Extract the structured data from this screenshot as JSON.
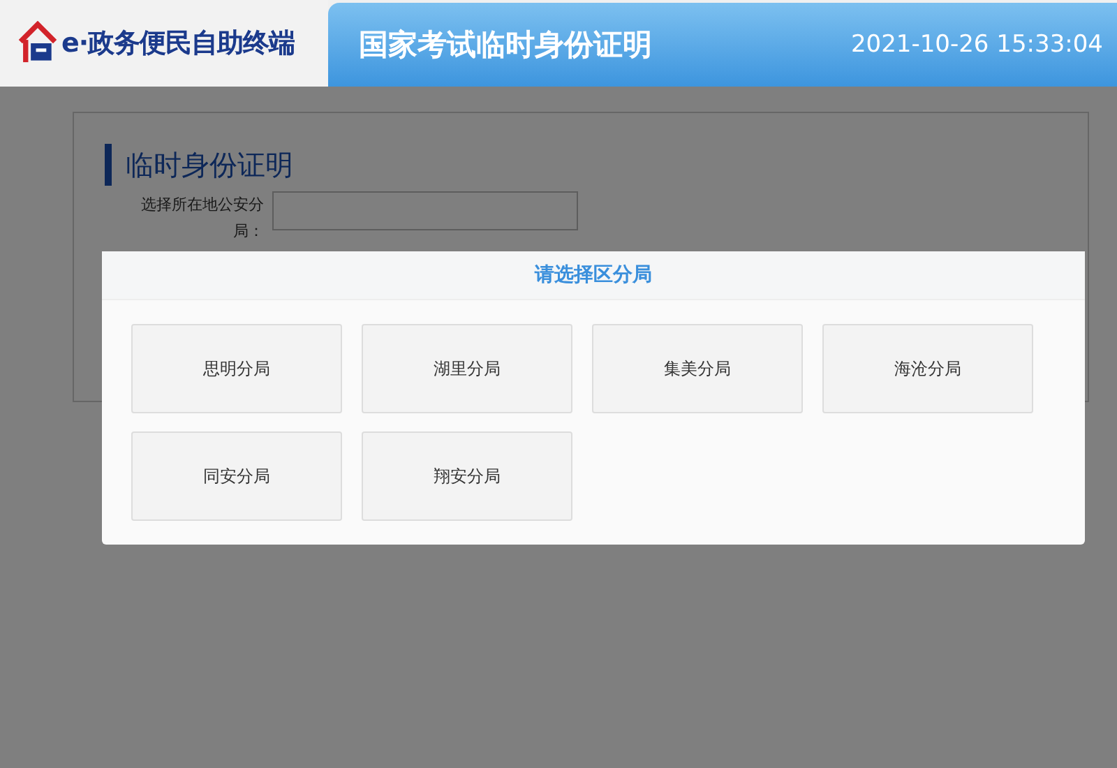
{
  "header": {
    "logo_text": "e·政务便民自助终端",
    "title": "国家考试临时身份证明",
    "datetime": "2021-10-26 15:33:04"
  },
  "form": {
    "heading": "临时身份证明",
    "field_label": "选择所在地公安分局："
  },
  "dialog": {
    "title": "请选择区分局",
    "options": [
      {
        "label": "思明分局"
      },
      {
        "label": "湖里分局"
      },
      {
        "label": "集美分局"
      },
      {
        "label": "海沧分局"
      },
      {
        "label": "同安分局"
      },
      {
        "label": "翔安分局"
      }
    ]
  }
}
